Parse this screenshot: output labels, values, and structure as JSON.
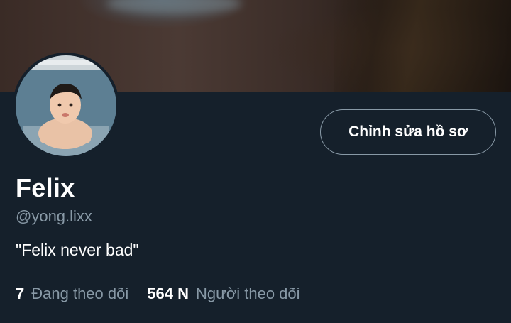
{
  "profile": {
    "name": "Felix",
    "handle": "@yong.lixx",
    "bio": "\"Felix never bad\"",
    "edit_button_label": "Chỉnh sửa hồ sơ",
    "banner_icon": "banner-photo",
    "avatar_icon": "avatar-photo"
  },
  "stats": {
    "following": {
      "count": "7",
      "label": "Đang theo dõi"
    },
    "followers": {
      "count": "564 N",
      "label": "Người theo dõi"
    }
  },
  "colors": {
    "background": "#15202b",
    "primary_text": "#ffffff",
    "secondary_text": "#8899a6",
    "button_border": "#8899a6"
  }
}
